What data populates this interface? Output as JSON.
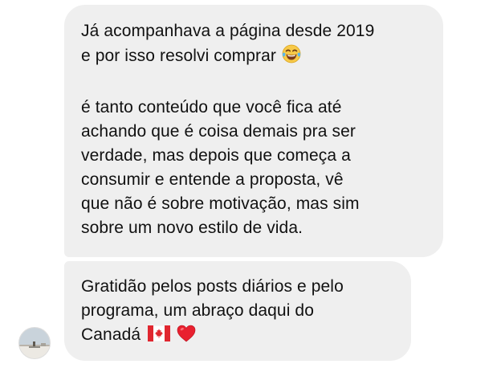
{
  "messages": [
    {
      "paragraphs": [
        "Já acompanhava a página desde 2019\ne por isso resolvi comprar",
        "é tanto conteúdo que você fica até\nachando que é coisa demais pra ser\nverdade, mas depois que começa a\nconsumir e entende a proposta, vê\nque não é sobre motivação, mas sim\nsobre um novo estilo de vida."
      ],
      "emoji": "face-with-tears-of-joy-icon"
    },
    {
      "text": "Gratidão pelos posts diários e pelo\nprograma, um abraço daqui do\nCanadá",
      "emojis": [
        "canada-flag-icon",
        "red-heart-icon"
      ]
    }
  ],
  "colors": {
    "bubble_background": "#efefef",
    "text": "#111111",
    "page_background": "#ffffff"
  }
}
